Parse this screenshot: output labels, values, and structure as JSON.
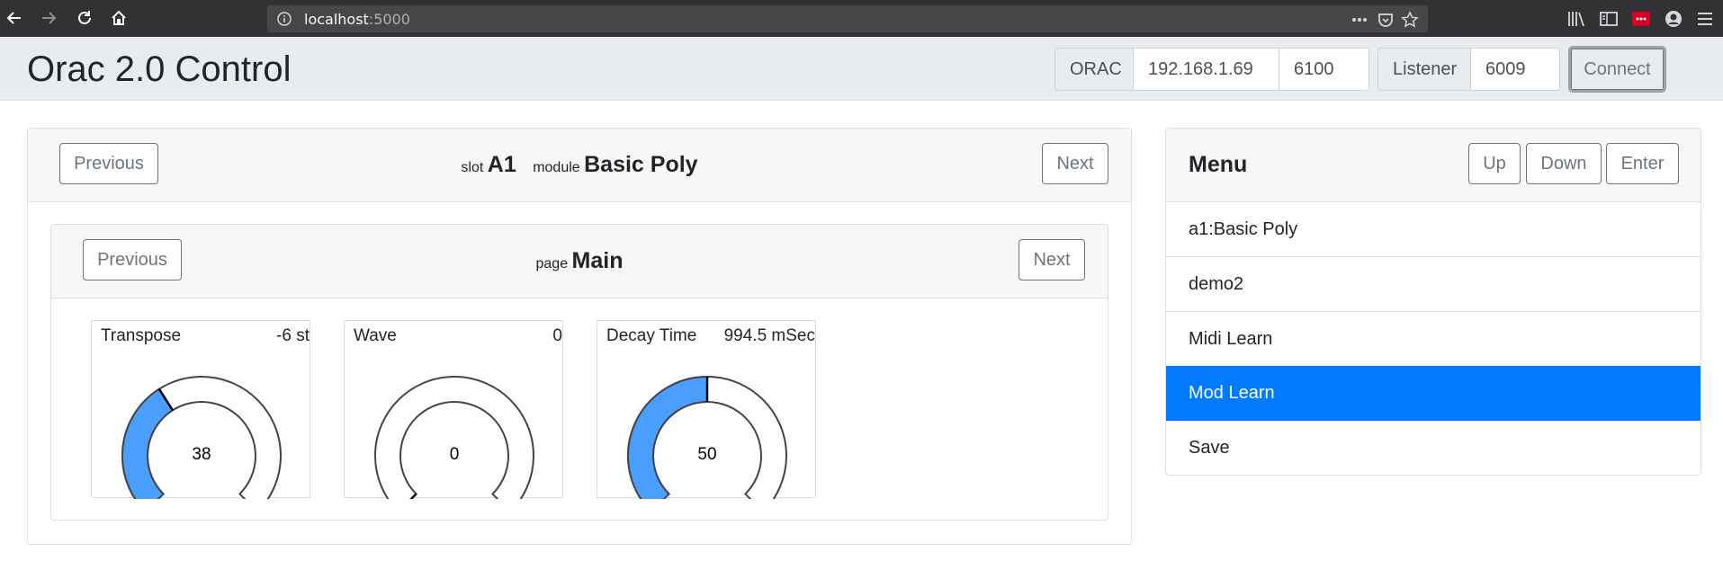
{
  "browser": {
    "url_host": "localhost",
    "url_port": ":5000"
  },
  "navbar": {
    "title": "Orac 2.0 Control",
    "orac_label": "ORAC",
    "orac_ip": "192.168.1.69",
    "orac_port": "6100",
    "listener_label": "Listener",
    "listener_port": "6009",
    "connect_label": "Connect"
  },
  "module_panel": {
    "prev_label": "Previous",
    "next_label": "Next",
    "slot_prefix": "slot",
    "slot_value": "A1",
    "module_prefix": "module",
    "module_value": "Basic Poly"
  },
  "page_panel": {
    "prev_label": "Previous",
    "next_label": "Next",
    "page_prefix": "page",
    "page_value": "Main"
  },
  "knobs": [
    {
      "name": "Transpose",
      "display": "-6 st",
      "value": "38",
      "level": 0.38,
      "fill_color": "#4a9eff"
    },
    {
      "name": "Wave",
      "display": "0",
      "value": "0",
      "level": 0.0,
      "fill_color": "#4a9eff"
    },
    {
      "name": "Decay Time",
      "display": "994.5 mSec",
      "value": "50",
      "level": 0.5,
      "fill_color": "#4a9eff"
    }
  ],
  "menu": {
    "title": "Menu",
    "up_label": "Up",
    "down_label": "Down",
    "enter_label": "Enter",
    "items": [
      {
        "label": "a1:Basic Poly",
        "active": false
      },
      {
        "label": "demo2",
        "active": false
      },
      {
        "label": "Midi Learn",
        "active": false
      },
      {
        "label": "Mod Learn",
        "active": true
      },
      {
        "label": "Save",
        "active": false
      }
    ]
  },
  "colors": {
    "accent": "#007bff",
    "knob_fill": "#4a9eff",
    "navbar_bg": "#e9ecef"
  }
}
